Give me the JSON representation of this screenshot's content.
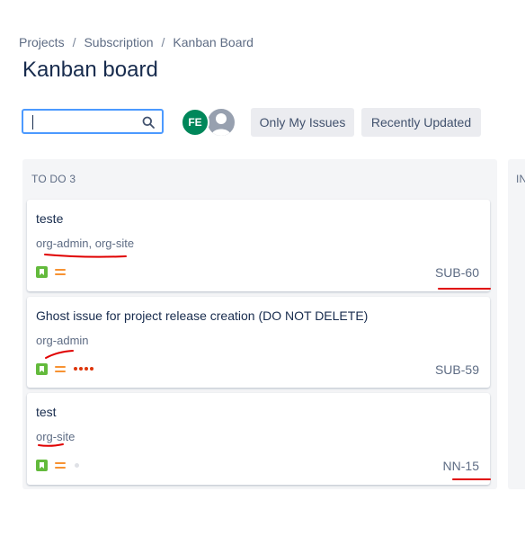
{
  "breadcrumb": {
    "items": [
      "Projects",
      "Subscription",
      "Kanban Board"
    ],
    "separator": "/"
  },
  "page": {
    "title": "Kanban board"
  },
  "search": {
    "value": "",
    "icon": "search-icon"
  },
  "avatars": [
    {
      "initials": "FE",
      "color": "#00875a"
    },
    {
      "initials": "",
      "color": "#97a0af",
      "icon": "user-icon"
    }
  ],
  "filters": {
    "only_my_issues": "Only My Issues",
    "recently_updated": "Recently Updated"
  },
  "columns": [
    {
      "title": "TO DO 3",
      "cards": [
        {
          "title": "teste",
          "labels": "org-admin, org-site",
          "issue_type": "story",
          "priority": "medium",
          "estimate_dots": 0,
          "key": "SUB-60"
        },
        {
          "title": "Ghost issue for project release creation (DO NOT DELETE)",
          "labels": "org-admin",
          "issue_type": "story",
          "priority": "medium",
          "estimate_dots": 4,
          "key": "SUB-59"
        },
        {
          "title": "test",
          "labels": "org-site",
          "issue_type": "story",
          "priority": "medium",
          "estimate_dots": 0,
          "estimate_empty": true,
          "key": "NN-15"
        }
      ]
    },
    {
      "title": "IN"
    }
  ],
  "colors": {
    "accent": "#4c9aff",
    "annotation": "#e00000",
    "story": "#63ba3c",
    "priority_medium": "#f79232"
  }
}
